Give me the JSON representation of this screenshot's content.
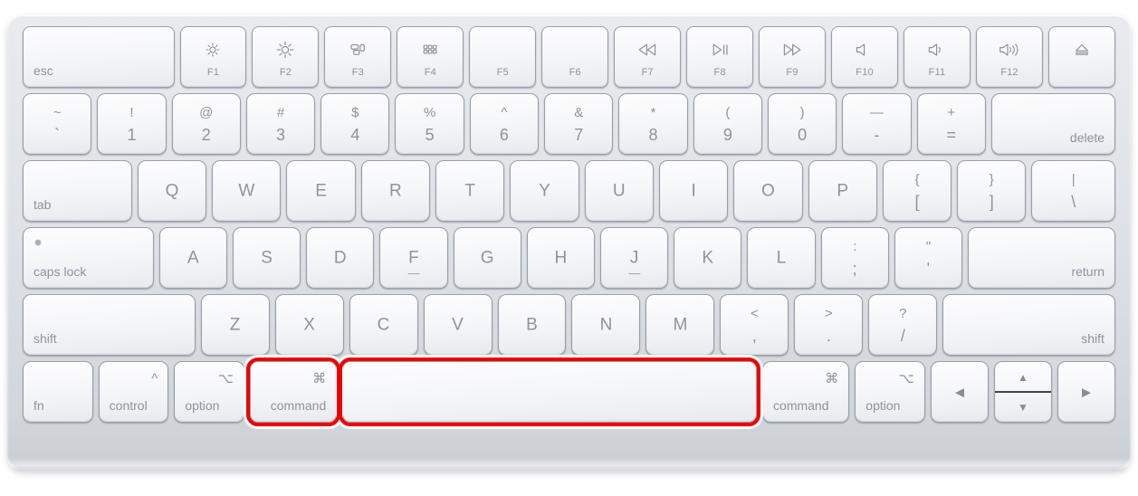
{
  "device": {
    "name": "apple-magic-keyboard",
    "body_color": "#dfe2e6",
    "key_color": "#f7f8fa",
    "legend_color": "#8d949c"
  },
  "annotation": {
    "highlight_color": "#f00000",
    "highlighted_keys": [
      "command-left",
      "space"
    ]
  },
  "rows": [
    {
      "id": "function-row",
      "keys": [
        {
          "name": "esc",
          "label": "esc",
          "align": "bottom-left",
          "flex": 2.3
        },
        {
          "name": "f1",
          "caption": "F1",
          "icon": "brightness-down-icon",
          "flex": 1.0
        },
        {
          "name": "f2",
          "caption": "F2",
          "icon": "brightness-up-icon",
          "flex": 1.0
        },
        {
          "name": "f3",
          "caption": "F3",
          "icon": "mission-control-icon",
          "flex": 1.0
        },
        {
          "name": "f4",
          "caption": "F4",
          "icon": "launchpad-icon",
          "flex": 1.0
        },
        {
          "name": "f5",
          "caption": "F5",
          "icon": "",
          "flex": 1.0
        },
        {
          "name": "f6",
          "caption": "F6",
          "icon": "",
          "flex": 1.0
        },
        {
          "name": "f7",
          "caption": "F7",
          "icon": "rewind-icon",
          "flex": 1.0
        },
        {
          "name": "f8",
          "caption": "F8",
          "icon": "play-pause-icon",
          "flex": 1.0
        },
        {
          "name": "f9",
          "caption": "F9",
          "icon": "fast-forward-icon",
          "flex": 1.0
        },
        {
          "name": "f10",
          "caption": "F10",
          "icon": "mute-icon",
          "flex": 1.0
        },
        {
          "name": "f11",
          "caption": "F11",
          "icon": "volume-down-icon",
          "flex": 1.0
        },
        {
          "name": "f12",
          "caption": "F12",
          "icon": "volume-up-icon",
          "flex": 1.0
        },
        {
          "name": "eject",
          "caption": "",
          "icon": "eject-icon",
          "flex": 1.0
        }
      ]
    },
    {
      "id": "number-row",
      "keys": [
        {
          "name": "backtick",
          "top": "~",
          "bottom": "`",
          "flex": 1.0
        },
        {
          "name": "digit-1",
          "top": "!",
          "bottom": "1",
          "flex": 1.0
        },
        {
          "name": "digit-2",
          "top": "@",
          "bottom": "2",
          "flex": 1.0
        },
        {
          "name": "digit-3",
          "top": "#",
          "bottom": "3",
          "flex": 1.0
        },
        {
          "name": "digit-4",
          "top": "$",
          "bottom": "4",
          "flex": 1.0
        },
        {
          "name": "digit-5",
          "top": "%",
          "bottom": "5",
          "flex": 1.0
        },
        {
          "name": "digit-6",
          "top": "^",
          "bottom": "6",
          "flex": 1.0
        },
        {
          "name": "digit-7",
          "top": "&",
          "bottom": "7",
          "flex": 1.0
        },
        {
          "name": "digit-8",
          "top": "*",
          "bottom": "8",
          "flex": 1.0
        },
        {
          "name": "digit-9",
          "top": "(",
          "bottom": "9",
          "flex": 1.0
        },
        {
          "name": "digit-0",
          "top": ")",
          "bottom": "0",
          "flex": 1.0
        },
        {
          "name": "minus",
          "top": "—",
          "bottom": "-",
          "flex": 1.0
        },
        {
          "name": "equals",
          "top": "+",
          "bottom": "=",
          "flex": 1.0
        },
        {
          "name": "delete",
          "label": "delete",
          "align": "bottom-right",
          "flex": 1.82
        }
      ]
    },
    {
      "id": "qwerty-row",
      "keys": [
        {
          "name": "tab",
          "label": "tab",
          "align": "bottom-left",
          "flex": 1.6
        },
        {
          "name": "key-q",
          "mid": "Q",
          "flex": 1.0
        },
        {
          "name": "key-w",
          "mid": "W",
          "flex": 1.0
        },
        {
          "name": "key-e",
          "mid": "E",
          "flex": 1.0
        },
        {
          "name": "key-r",
          "mid": "R",
          "flex": 1.0
        },
        {
          "name": "key-t",
          "mid": "T",
          "flex": 1.0
        },
        {
          "name": "key-y",
          "mid": "Y",
          "flex": 1.0
        },
        {
          "name": "key-u",
          "mid": "U",
          "flex": 1.0
        },
        {
          "name": "key-i",
          "mid": "I",
          "flex": 1.0
        },
        {
          "name": "key-o",
          "mid": "O",
          "flex": 1.0
        },
        {
          "name": "key-p",
          "mid": "P",
          "flex": 1.0
        },
        {
          "name": "bracket-left",
          "top": "{",
          "bottom": "[",
          "flex": 1.0
        },
        {
          "name": "bracket-right",
          "top": "}",
          "bottom": "]",
          "flex": 1.0
        },
        {
          "name": "backslash",
          "top": "|",
          "bottom": "\\",
          "flex": 1.22
        }
      ]
    },
    {
      "id": "home-row",
      "keys": [
        {
          "name": "caps-lock",
          "label": "caps lock",
          "align": "bottom-left",
          "led": true,
          "flex": 1.95
        },
        {
          "name": "key-a",
          "mid": "A",
          "flex": 1.0
        },
        {
          "name": "key-s",
          "mid": "S",
          "flex": 1.0
        },
        {
          "name": "key-d",
          "mid": "D",
          "flex": 1.0
        },
        {
          "name": "key-f",
          "mid": "F",
          "homing": true,
          "flex": 1.0
        },
        {
          "name": "key-g",
          "mid": "G",
          "flex": 1.0
        },
        {
          "name": "key-h",
          "mid": "H",
          "flex": 1.0
        },
        {
          "name": "key-j",
          "mid": "J",
          "homing": true,
          "flex": 1.0
        },
        {
          "name": "key-k",
          "mid": "K",
          "flex": 1.0
        },
        {
          "name": "key-l",
          "mid": "L",
          "flex": 1.0
        },
        {
          "name": "semicolon",
          "top": ":",
          "bottom": ";",
          "flex": 1.0
        },
        {
          "name": "quote",
          "top": "\"",
          "bottom": "'",
          "flex": 1.0
        },
        {
          "name": "return",
          "label": "return",
          "align": "bottom-right",
          "flex": 2.2
        }
      ]
    },
    {
      "id": "shift-row",
      "keys": [
        {
          "name": "shift-left",
          "label": "shift",
          "align": "bottom-left",
          "flex": 2.55
        },
        {
          "name": "key-z",
          "mid": "Z",
          "flex": 1.0
        },
        {
          "name": "key-x",
          "mid": "X",
          "flex": 1.0
        },
        {
          "name": "key-c",
          "mid": "C",
          "flex": 1.0
        },
        {
          "name": "key-v",
          "mid": "V",
          "flex": 1.0
        },
        {
          "name": "key-b",
          "mid": "B",
          "flex": 1.0
        },
        {
          "name": "key-n",
          "mid": "N",
          "flex": 1.0
        },
        {
          "name": "key-m",
          "mid": "M",
          "flex": 1.0
        },
        {
          "name": "comma",
          "top": "<",
          "bottom": ",",
          "flex": 1.0
        },
        {
          "name": "period",
          "top": ">",
          "bottom": ".",
          "flex": 1.0
        },
        {
          "name": "slash",
          "top": "?",
          "bottom": "/",
          "flex": 1.0
        },
        {
          "name": "shift-right",
          "label": "shift",
          "align": "bottom-right",
          "flex": 2.55
        }
      ]
    },
    {
      "id": "bottom-row",
      "keys": [
        {
          "name": "fn",
          "label": "fn",
          "align": "bottom-left",
          "flex": 1.22
        },
        {
          "name": "control",
          "label": "control",
          "align": "bottom-left",
          "glyph": "^",
          "flex": 1.22
        },
        {
          "name": "option-left",
          "label": "option",
          "align": "bottom-left",
          "glyph": "⌥",
          "flex": 1.22
        },
        {
          "name": "command-left",
          "label": "command",
          "align": "bottom-right",
          "glyph": "⌘",
          "flex": 1.52,
          "highlight": true
        },
        {
          "name": "space",
          "label": "",
          "flex": 7.35,
          "highlight": true
        },
        {
          "name": "command-right",
          "label": "command",
          "align": "bottom-left",
          "glyph": "⌘",
          "flex": 1.52
        },
        {
          "name": "option-right",
          "label": "option",
          "align": "bottom-left",
          "glyph": "⌥",
          "flex": 1.22
        },
        {
          "name": "arrow-left",
          "arrow": "◀",
          "flex": 1.0
        },
        {
          "name": "arrow-up-down",
          "updown": true,
          "up": "▲",
          "down": "▼",
          "flex": 1.0
        },
        {
          "name": "arrow-right",
          "arrow": "▶",
          "flex": 1.0
        }
      ]
    }
  ]
}
